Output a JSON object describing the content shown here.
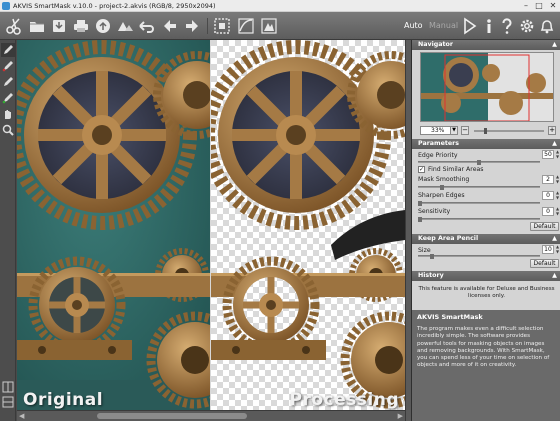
{
  "window": {
    "title": "AKVIS SmartMask v.10.0 - project-2.akvis (RGB/8, 2950x2094)",
    "controls": {
      "minimize": "–",
      "maximize": "□",
      "close": "✕"
    }
  },
  "toolbar": {
    "left_icons": [
      "scissors-logo-icon",
      "open-file-icon",
      "save-icon",
      "print-icon",
      "upload-icon",
      "share-icon",
      "undo-icon",
      "redo-icon",
      "arrow-left-icon",
      "arrow-right-icon",
      "select-icon",
      "crop-icon",
      "tone-curve-icon",
      "chroma-key-icon"
    ],
    "mode_auto": "Auto",
    "mode_manual": "Manual",
    "right_icons": [
      "run-icon",
      "info-icon",
      "help-icon",
      "settings-icon",
      "notifications-icon"
    ]
  },
  "left_tools": [
    "pencil-icon",
    "brush-icon",
    "eraser-icon",
    "smudge-icon",
    "hand-icon",
    "zoom-icon"
  ],
  "canvas": {
    "left_label": "Original",
    "right_label": "Processing"
  },
  "navigator": {
    "header": "Navigator",
    "zoom_value": "33%"
  },
  "parameters": {
    "header": "Parameters",
    "edge_priority_label": "Edge Priority",
    "edge_priority_value": "50",
    "find_similar_label": "Find Similar Areas",
    "find_similar_checked": true,
    "mask_smoothing_label": "Mask Smoothing",
    "mask_smoothing_value": "2",
    "sharpen_edges_label": "Sharpen Edges",
    "sharpen_edges_value": "0",
    "sensitivity_label": "Sensitivity",
    "sensitivity_value": "0",
    "default_label": "Default"
  },
  "keep_area": {
    "header": "Keep Area Pencil",
    "size_label": "Size",
    "size_value": "10",
    "default_label": "Default"
  },
  "history": {
    "header": "History",
    "note": "This feature is available for Deluxe and Business licenses only."
  },
  "info": {
    "title": "AKVIS SmartMask",
    "text": "The program makes even a difficult selection incredibly simple. The software provides powerful tools for masking objects on images and removing backgrounds. With SmartMask, you can spend less of your time on selection of objects and more of it on creativity."
  },
  "colors": {
    "teal_bg": "#2f6d6a",
    "bronze": "#a57a45",
    "panel_bg": "#d4d4d4",
    "header_bg": "#666666"
  }
}
